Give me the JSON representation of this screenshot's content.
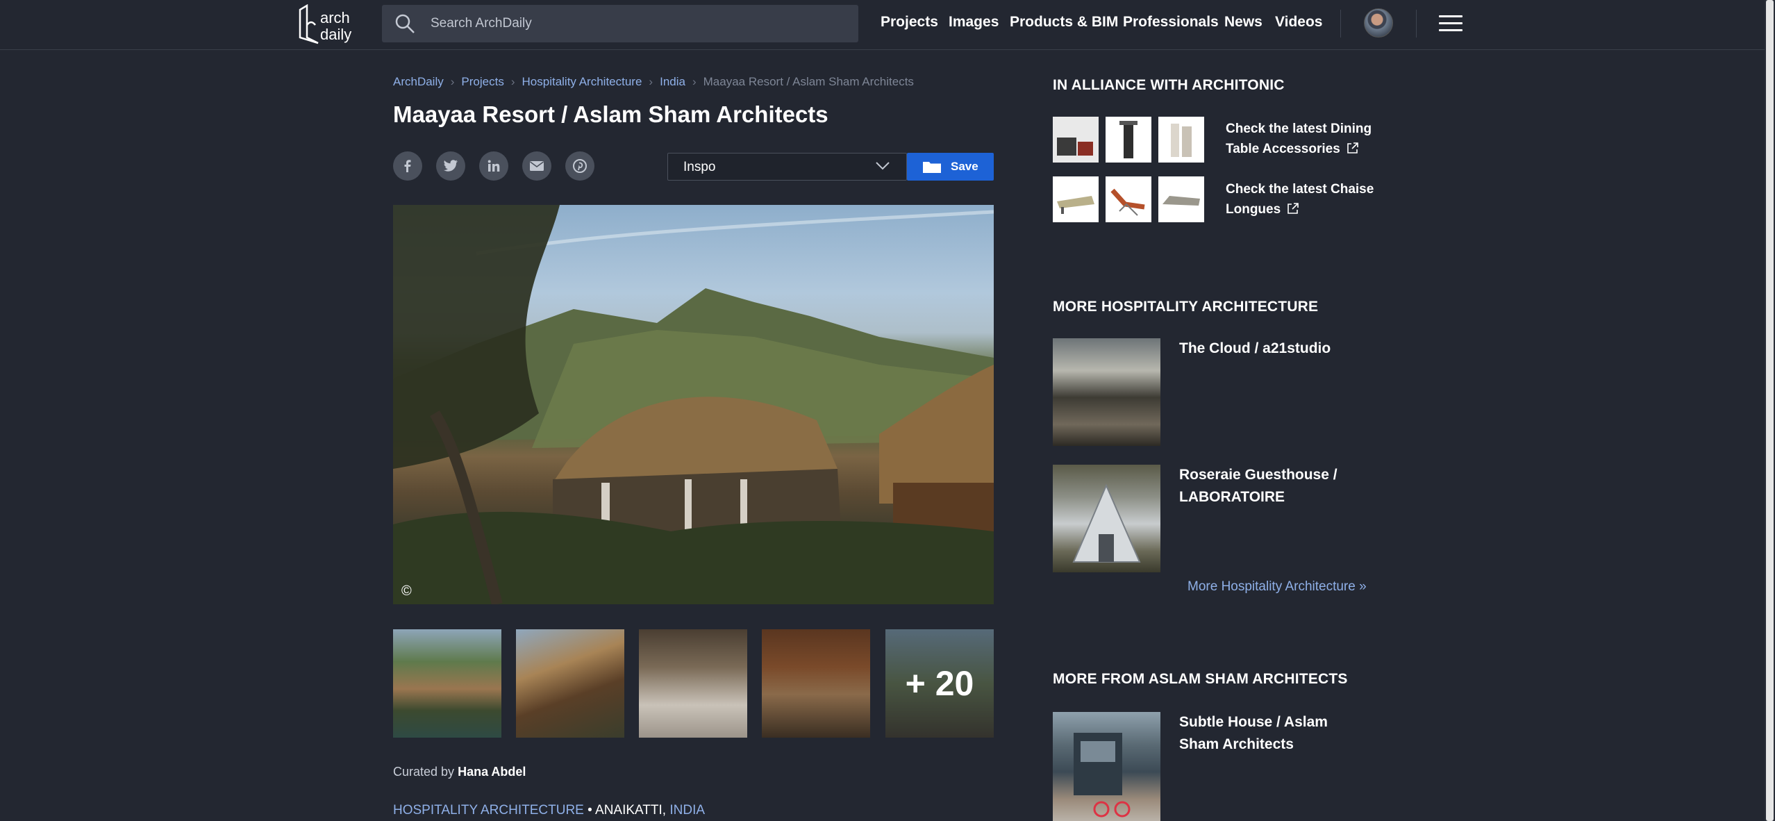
{
  "header": {
    "logo_text": "arch daily",
    "search_placeholder": "Search ArchDaily",
    "nav": [
      "Projects",
      "Images",
      "Products & BIM",
      "Professionals",
      "News",
      "Videos"
    ]
  },
  "breadcrumb": {
    "items": [
      "ArchDaily",
      "Projects",
      "Hospitality Architecture",
      "India"
    ],
    "current": "Maayaa Resort / Aslam Sham Architects"
  },
  "article": {
    "title": "Maayaa Resort / Aslam Sham Architects",
    "share_icons": [
      "facebook-icon",
      "twitter-icon",
      "linkedin-icon",
      "email-icon",
      "pinterest-icon"
    ],
    "collection_value": "Inspo",
    "save_label": "Save",
    "copyright_symbol": "©",
    "more_photos": "+ 20",
    "curated_prefix": "Curated by",
    "curator": "Hana Abdel",
    "tags": {
      "category": "HOSPITALITY ARCHITECTURE",
      "separator": "•",
      "city": "ANAIKATTI,",
      "country": "INDIA"
    }
  },
  "sidebar": {
    "alliance": {
      "heading": "IN ALLIANCE WITH ARCHITONIC",
      "promos": [
        "Check the latest Dining Table Accessories",
        "Check the latest Chaise Longues"
      ]
    },
    "hospitality": {
      "heading": "MORE HOSPITALITY ARCHITECTURE",
      "items": [
        "The Cloud / a21studio",
        "Roseraie Guesthouse / LABORATOIRE"
      ],
      "more_link": "More Hospitality Architecture »"
    },
    "office": {
      "heading": "MORE FROM ASLAM SHAM ARCHITECTS",
      "items": [
        "Subtle House / Aslam Sham Architects"
      ]
    }
  },
  "colors": {
    "background": "#232731",
    "link": "#8fb0e8",
    "save_button": "#1d62d6"
  }
}
